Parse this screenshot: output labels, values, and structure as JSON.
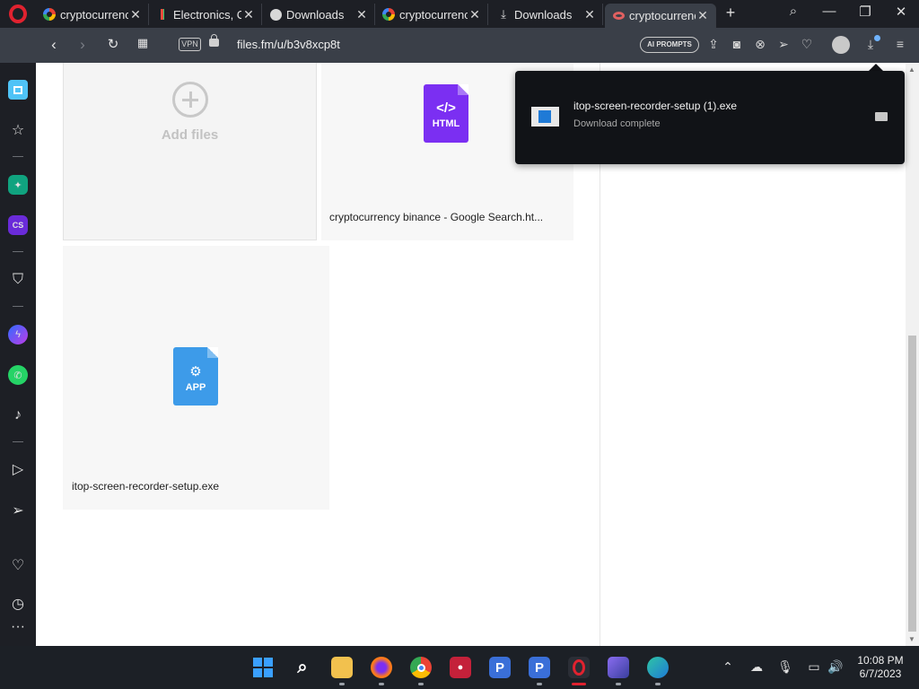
{
  "tabs": [
    {
      "title": "cryptocurrenc",
      "icon": "google-icon",
      "active": false
    },
    {
      "title": "Electronics, C",
      "icon": "store-icon",
      "active": false
    },
    {
      "title": "Downloads",
      "icon": "globe-icon",
      "active": false
    },
    {
      "title": "cryptocurrenc",
      "icon": "google-icon",
      "active": false
    },
    {
      "title": "Downloads",
      "icon": "download-icon",
      "active": false
    },
    {
      "title": "cryptocurrenc",
      "icon": "google-icon",
      "active": true
    }
  ],
  "addressbar": {
    "vpn_label": "VPN",
    "url": "files.fm/u/b3v8xcp8t",
    "ai_prompts_label": "AI PROMPTS"
  },
  "content": {
    "add_files_label": "Add files",
    "files": [
      {
        "name": "cryptocurrency binance - Google Search.ht...",
        "type_label": "HTML",
        "symbol": "</>",
        "color": "#7b2ff2"
      },
      {
        "name": "itop-screen-recorder-setup.exe",
        "type_label": "APP",
        "symbol": "⚙",
        "color": "#3d9be9"
      }
    ]
  },
  "download_popup": {
    "filename": "itop-screen-recorder-setup (1).exe",
    "status": "Download complete"
  },
  "taskbar": {
    "time": "10:08 PM",
    "date": "6/7/2023"
  },
  "colors": {
    "opera_red": "#e0222f",
    "chrome_dark": "#1d1f25",
    "toolbar": "#3a3f48"
  }
}
